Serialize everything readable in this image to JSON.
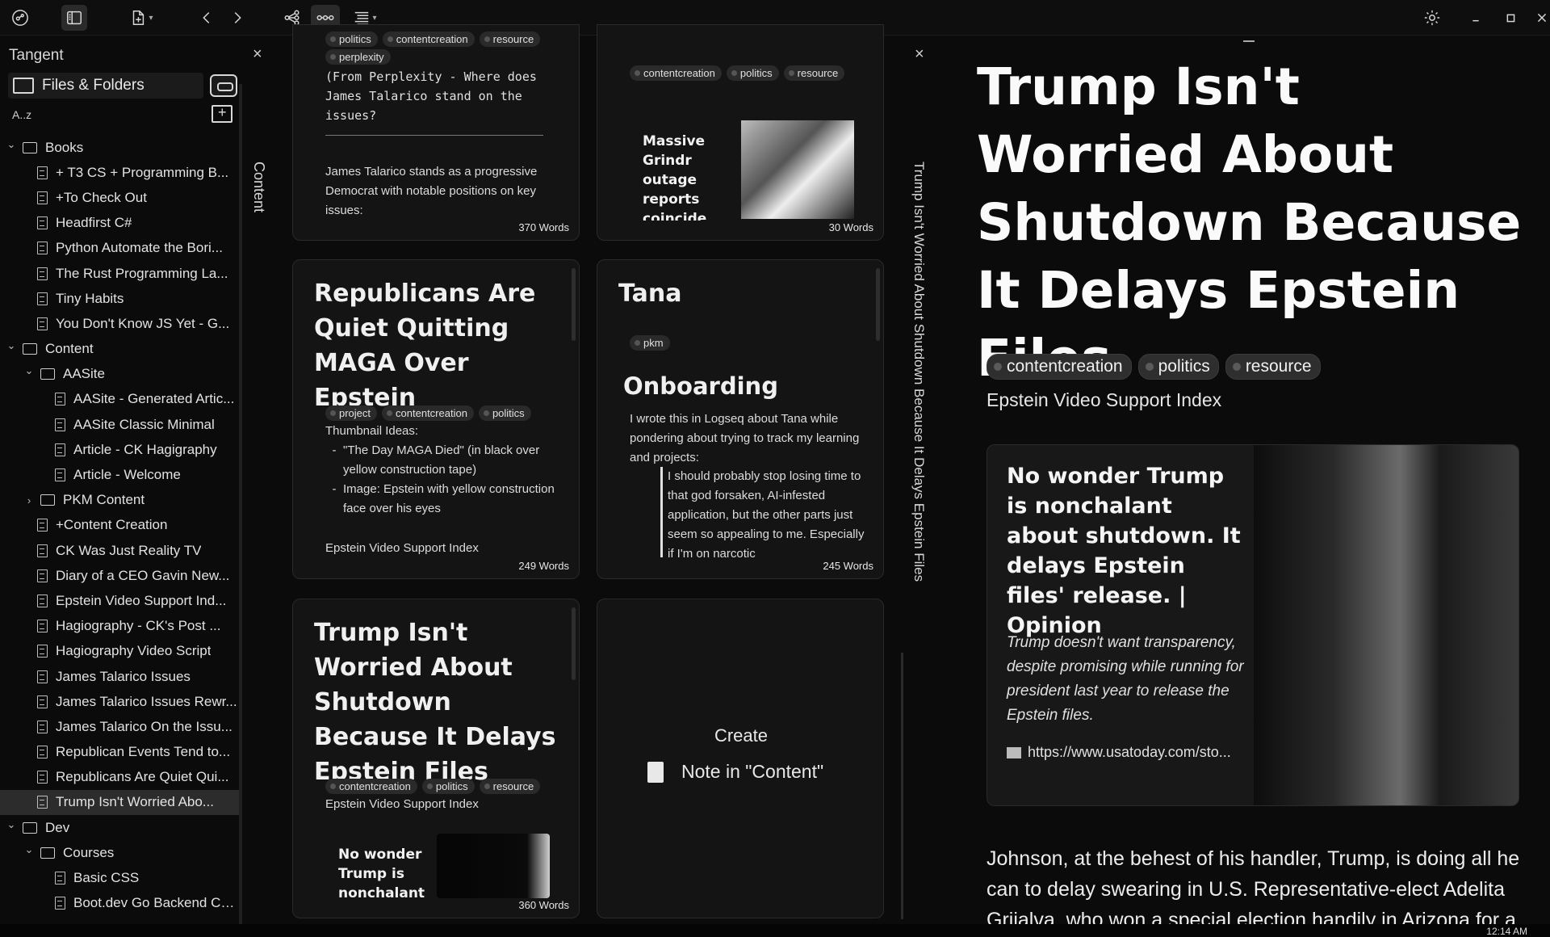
{
  "toolbar": {
    "icons": [
      "graph-icon",
      "sidebar-toggle-icon",
      "new-note-icon",
      "back-icon",
      "forward-icon",
      "tree-view-icon",
      "thread-view-icon",
      "list-view-icon",
      "settings-icon",
      "minimize-icon",
      "maximize-icon",
      "close-icon"
    ]
  },
  "sidebar": {
    "title": "Tangent",
    "files_tab": "Files & Folders",
    "sort_label": "A..z",
    "items": [
      {
        "type": "folder",
        "depth": 0,
        "label": "Books",
        "open": true
      },
      {
        "type": "file",
        "depth": 1,
        "label": "+ T3 CS + Programming B..."
      },
      {
        "type": "file",
        "depth": 1,
        "label": "+To Check Out"
      },
      {
        "type": "file",
        "depth": 1,
        "label": "Headfirst C#"
      },
      {
        "type": "file",
        "depth": 1,
        "label": "Python Automate the Bori..."
      },
      {
        "type": "file",
        "depth": 1,
        "label": "The Rust Programming La..."
      },
      {
        "type": "file",
        "depth": 1,
        "label": "Tiny Habits"
      },
      {
        "type": "file",
        "depth": 1,
        "label": "You Don't Know JS Yet - G..."
      },
      {
        "type": "folder",
        "depth": 0,
        "label": "Content",
        "open": true
      },
      {
        "type": "folder",
        "depth": 1,
        "label": "AASite",
        "open": true
      },
      {
        "type": "file",
        "depth": 2,
        "label": "AASite - Generated Artic..."
      },
      {
        "type": "file",
        "depth": 2,
        "label": "AASite Classic Minimal"
      },
      {
        "type": "file",
        "depth": 2,
        "label": "Article - CK Hagigraphy"
      },
      {
        "type": "file",
        "depth": 2,
        "label": "Article - Welcome"
      },
      {
        "type": "folder",
        "depth": 1,
        "label": "PKM Content",
        "open": false
      },
      {
        "type": "file",
        "depth": 1,
        "label": "+Content Creation"
      },
      {
        "type": "file",
        "depth": 1,
        "label": "CK Was Just Reality TV"
      },
      {
        "type": "file",
        "depth": 1,
        "label": "Diary of a CEO Gavin New..."
      },
      {
        "type": "file",
        "depth": 1,
        "label": "Epstein Video Support Ind..."
      },
      {
        "type": "file",
        "depth": 1,
        "label": "Hagiography - CK's Post ..."
      },
      {
        "type": "file",
        "depth": 1,
        "label": "Hagiography Video Script"
      },
      {
        "type": "file",
        "depth": 1,
        "label": "James Talarico Issues"
      },
      {
        "type": "file",
        "depth": 1,
        "label": "James Talarico Issues Rewr..."
      },
      {
        "type": "file",
        "depth": 1,
        "label": "James Talarico On the Issu..."
      },
      {
        "type": "file",
        "depth": 1,
        "label": "Republican Events Tend to..."
      },
      {
        "type": "file",
        "depth": 1,
        "label": "Republicans Are Quiet Qui..."
      },
      {
        "type": "file",
        "depth": 1,
        "label": "Trump Isn't Worried Abo...",
        "selected": true
      },
      {
        "type": "folder",
        "depth": 0,
        "label": "Dev",
        "open": true
      },
      {
        "type": "folder",
        "depth": 1,
        "label": "Courses",
        "open": true
      },
      {
        "type": "file",
        "depth": 2,
        "label": "Basic CSS"
      },
      {
        "type": "file",
        "depth": 2,
        "label": "Boot.dev Go Backend Co..."
      }
    ]
  },
  "content_pane": {
    "label": "Content",
    "cards": {
      "talarico": {
        "tags_top": [
          "politics",
          "contentcreation",
          "resource"
        ],
        "tag_extra": "perplexity",
        "mono_lines": [
          "(From Perplexity - Where does",
          "James Talarico stand on the",
          "issues?"
        ],
        "body": "James Talarico stands as a progressive Democrat with notable positions on key issues:",
        "words": "370 Words"
      },
      "grindr": {
        "tags": [
          "contentcreation",
          "politics",
          "resource"
        ],
        "headline": "Massive Grindr outage reports coincide",
        "words": "30 Words"
      },
      "republicans": {
        "title": "Republicans Are Quiet Quitting MAGA Over Epstein",
        "tags": [
          "project",
          "contentcreation",
          "politics"
        ],
        "intro": "Thumbnail Ideas:",
        "bullets": [
          "\"The Day MAGA Died\" (in black over yellow construction tape)",
          "Image: Epstein with yellow construction face over his eyes"
        ],
        "ref": "Epstein Video Support Index",
        "words": "249 Words"
      },
      "tana": {
        "title": "Tana",
        "tags": [
          "pkm"
        ],
        "subtitle": "Onboarding",
        "body": "I wrote this in Logseq about Tana while pondering about trying to track my learning and projects:",
        "quote": "I should probably stop losing time to that god forsaken, AI-infested application, but the other parts just seem so appealing to me. Especially if I'm on narcotic",
        "words": "245 Words"
      },
      "trump": {
        "title": "Trump Isn't Worried About Shutdown Because It Delays Epstein Files",
        "tags": [
          "contentcreation",
          "politics",
          "resource"
        ],
        "ref": "Epstein Video Support Index",
        "embed_text": "No wonder Trump is nonchalant",
        "words": "360 Words"
      },
      "create": {
        "label": "Create",
        "note_label": "Note in \"Content\""
      }
    }
  },
  "doc_pane": {
    "vertical_label": "Trump Isn't Worried About Shutdown Because It Delays Epstein Files",
    "title": "Trump Isn't Worried About Shutdown Because It Delays Epstein Files",
    "tags": [
      "contentcreation",
      "politics",
      "resource"
    ],
    "ref": "Epstein Video Support Index",
    "embed": {
      "title": "No wonder Trump is nonchalant about shutdown. It delays Epstein files' release. | Opinion",
      "description": "Trump doesn't want transparency, despite promising while running for president last year to release the Epstein files.",
      "url": "https://www.usatoday.com/sto..."
    },
    "body": "Johnson, at the behest of his handler, Trump, is doing all he can to delay swearing in U.S. Representative-elect Adelita Grijalva, who won a special election handily in Arizona for a"
  },
  "taskbar": {
    "time": "12:14 AM"
  }
}
